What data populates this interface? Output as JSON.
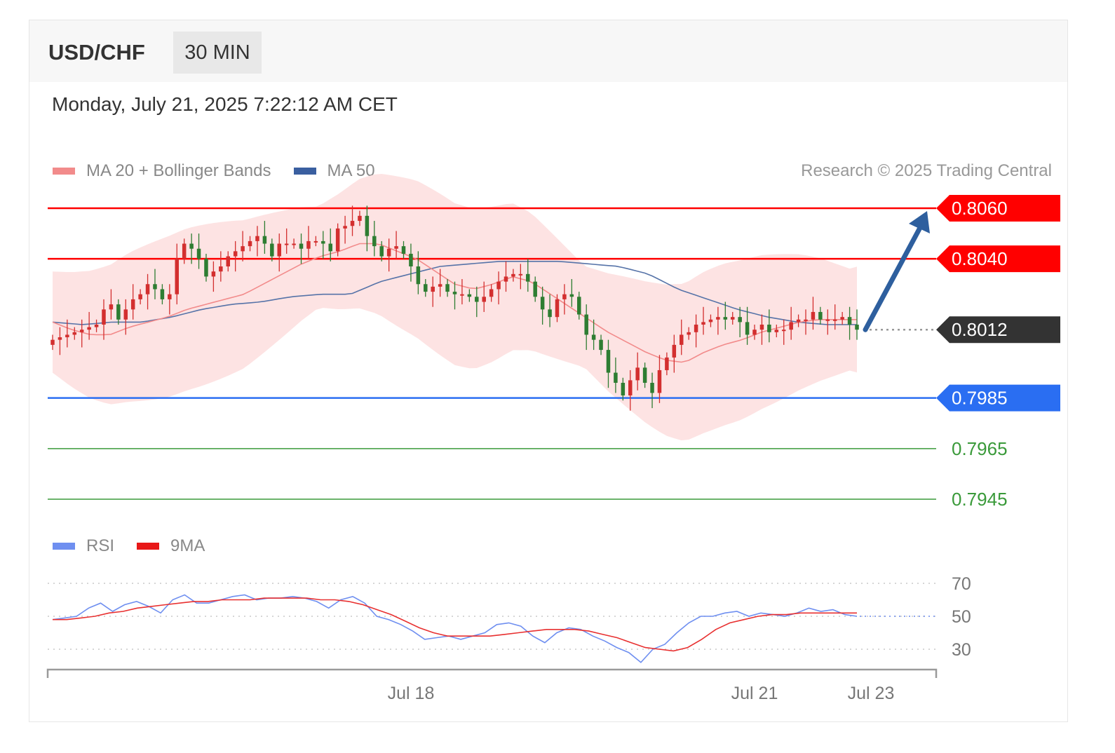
{
  "header": {
    "symbol": "USD/CHF",
    "timeframe": "30 MIN",
    "timestamp": "Monday, July 21, 2025 7:22:12 AM CET",
    "credit": "Research © 2025 Trading Central"
  },
  "legend": {
    "ma20": "MA 20 + Bollinger Bands",
    "ma50": "MA 50",
    "rsi": "RSI",
    "ma9": "9MA"
  },
  "colors": {
    "resistance": "#ff0000",
    "pivot": "#333333",
    "support1": "#2a6ef2",
    "support": "#3a9a3a",
    "arrow": "#2e5f9e",
    "bull": "#d32f2f",
    "bear": "#2e7d32",
    "ma20": "#f28b8b",
    "ma50": "#5673a8",
    "band": "#fde3e3",
    "rsi": "#6f8ff0",
    "ma9": "#e83030"
  },
  "chart_data": {
    "type": "candlestick",
    "title": "USD/CHF",
    "timeframe": "30 MIN",
    "x_tick_labels": [
      "Jul 18",
      "Jul 21",
      "Jul 23"
    ],
    "ylim": [
      0.7935,
      0.8071
    ],
    "levels": [
      {
        "label": "0.8060",
        "value": 0.806,
        "kind": "resistance"
      },
      {
        "label": "0.8040",
        "value": 0.804,
        "kind": "resistance"
      },
      {
        "label": "0.8012",
        "value": 0.8012,
        "kind": "pivot"
      },
      {
        "label": "0.7985",
        "value": 0.7985,
        "kind": "support1"
      },
      {
        "label": "0.7965",
        "value": 0.7965,
        "kind": "support"
      },
      {
        "label": "0.7945",
        "value": 0.7945,
        "kind": "support"
      }
    ],
    "forecast_arrow": {
      "from": 0.8012,
      "to": 0.806
    },
    "close": [
      0.8008,
      0.8009,
      0.801,
      0.8011,
      0.8012,
      0.8013,
      0.8014,
      0.802,
      0.8022,
      0.8016,
      0.802,
      0.8024,
      0.8026,
      0.803,
      0.8028,
      0.8024,
      0.8026,
      0.804,
      0.8046,
      0.8044,
      0.804,
      0.8033,
      0.8035,
      0.8037,
      0.8041,
      0.8043,
      0.8045,
      0.8047,
      0.8049,
      0.8046,
      0.8041,
      0.8046,
      0.8046,
      0.8046,
      0.8044,
      0.8047,
      0.8047,
      0.8046,
      0.8043,
      0.8052,
      0.8053,
      0.8055,
      0.8057,
      0.8049,
      0.8045,
      0.8041,
      0.8044,
      0.8045,
      0.8042,
      0.8037,
      0.803,
      0.8027,
      0.8029,
      0.803,
      0.8027,
      0.8026,
      0.8026,
      0.8025,
      0.8023,
      0.8025,
      0.8028,
      0.8031,
      0.8033,
      0.8034,
      0.8034,
      0.8031,
      0.8025,
      0.802,
      0.8017,
      0.8024,
      0.8026,
      0.8025,
      0.8018,
      0.801,
      0.8008,
      0.8004,
      0.7995,
      0.7991,
      0.7986,
      0.7992,
      0.7997,
      0.7991,
      0.7987,
      0.7996,
      0.8001,
      0.8006,
      0.801,
      0.8011,
      0.8014,
      0.8015,
      0.8016,
      0.8017,
      0.8016,
      0.8017,
      0.8015,
      0.801,
      0.8012,
      0.8014,
      0.8011,
      0.8012,
      0.8012,
      0.8015,
      0.8016,
      0.8016,
      0.8019,
      0.8016,
      0.8016,
      0.8016,
      0.8017,
      0.8014,
      0.8012
    ],
    "ma20": [
      0.8015,
      0.8012,
      0.801,
      0.801,
      0.8013,
      0.8015,
      0.8017,
      0.802,
      0.8022,
      0.8024,
      0.8026,
      0.803,
      0.8034,
      0.8038,
      0.8041,
      0.8043,
      0.8046,
      0.8046,
      0.8043,
      0.804,
      0.8035,
      0.803,
      0.8028,
      0.803,
      0.8033,
      0.8031,
      0.8026,
      0.8021,
      0.8016,
      0.8011,
      0.8007,
      0.8003,
      0.8,
      0.7999,
      0.8003,
      0.8006,
      0.8008,
      0.8011,
      0.8013,
      0.8015,
      0.8016,
      0.8016,
      0.8016
    ],
    "ma50": [
      0.8015,
      0.8014,
      0.8015,
      0.8015,
      0.8017,
      0.802,
      0.8022,
      0.8023,
      0.8025,
      0.8026,
      0.8026,
      0.8031,
      0.8034,
      0.8037,
      0.8038,
      0.8039,
      0.8039,
      0.8039,
      0.8038,
      0.8037,
      0.8034,
      0.8028,
      0.8024,
      0.802,
      0.8017,
      0.8015,
      0.8014,
      0.8014
    ],
    "rsi_panel": {
      "levels": [
        70,
        50,
        30
      ],
      "rsi": [
        48,
        49,
        50,
        55,
        58,
        53,
        57,
        59,
        56,
        52,
        60,
        63,
        58,
        58,
        60,
        62,
        63,
        60,
        61,
        61,
        62,
        61,
        59,
        55,
        60,
        62,
        58,
        50,
        48,
        45,
        41,
        36,
        37,
        38,
        36,
        38,
        40,
        45,
        46,
        44,
        38,
        34,
        40,
        43,
        42,
        38,
        35,
        31,
        28,
        22,
        30,
        33,
        40,
        46,
        50,
        50,
        52,
        53,
        50,
        52,
        51,
        50,
        52,
        55,
        53,
        54,
        51,
        50
      ],
      "ma9": [
        48,
        48,
        49,
        50,
        52,
        53,
        55,
        56,
        57,
        58,
        59,
        59,
        60,
        60,
        60,
        61,
        61,
        61,
        61,
        60,
        60,
        59,
        57,
        54,
        51,
        47,
        43,
        40,
        38,
        38,
        38,
        38,
        39,
        40,
        41,
        42,
        42,
        42,
        41,
        39,
        37,
        34,
        31,
        30,
        29,
        31,
        36,
        42,
        46,
        48,
        50,
        51,
        51,
        52,
        52,
        52,
        52,
        52
      ]
    }
  }
}
